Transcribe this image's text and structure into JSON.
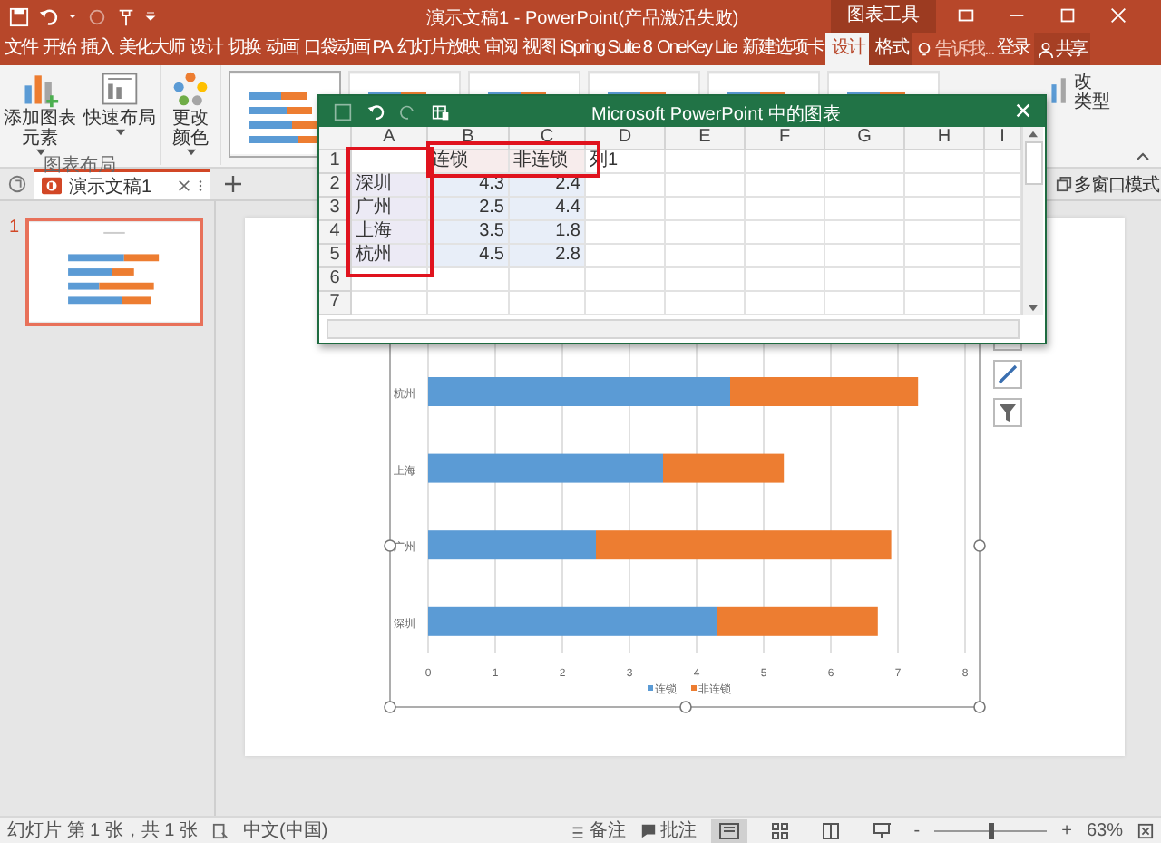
{
  "title_bar": {
    "title": "演示文稿1 - PowerPoint(产品激活失败)",
    "context_label": "图表工具"
  },
  "ribbon_tabs": [
    {
      "label": "文件",
      "kind": "main",
      "selected": false
    },
    {
      "label": "开始",
      "kind": "main",
      "selected": false
    },
    {
      "label": "插入",
      "kind": "main",
      "selected": false
    },
    {
      "label": "美化大师",
      "kind": "main",
      "selected": false
    },
    {
      "label": "设计",
      "kind": "main",
      "selected": false
    },
    {
      "label": "切换",
      "kind": "main",
      "selected": false
    },
    {
      "label": "动画",
      "kind": "main",
      "selected": false
    },
    {
      "label": "口袋动画 PA",
      "kind": "main",
      "selected": false
    },
    {
      "label": "幻灯片放映",
      "kind": "main",
      "selected": false
    },
    {
      "label": "审阅",
      "kind": "main",
      "selected": false
    },
    {
      "label": "视图",
      "kind": "main",
      "selected": false
    },
    {
      "label": "iSpring Suite 8",
      "kind": "main",
      "selected": false
    },
    {
      "label": "OneKey Lite",
      "kind": "main",
      "selected": false
    },
    {
      "label": "新建选项卡",
      "kind": "main",
      "selected": false
    },
    {
      "label": "设计",
      "kind": "context",
      "selected": true
    },
    {
      "label": "格式",
      "kind": "context",
      "selected": false
    }
  ],
  "tell_me": "告诉我...",
  "sign_in": "登录",
  "share": "共享",
  "ribbon": {
    "buttons": [
      {
        "label": "添加图表元素",
        "kind": "elements"
      },
      {
        "label": "快速布局",
        "kind": "layout"
      },
      {
        "label": "更改颜色",
        "kind": "colors"
      }
    ],
    "group_label": "图表布局",
    "partial_texts": [
      "改",
      "类型"
    ]
  },
  "doc_tab": {
    "title": "演示文稿1"
  },
  "multi_window": "多窗口模式",
  "slides": [
    {
      "number": "1",
      "selected": true
    }
  ],
  "chart_data": {
    "type": "bar",
    "orientation": "horizontal",
    "stacked": true,
    "grid": true,
    "legend": "bottom",
    "categories": [
      "杭州",
      "上海",
      "广州",
      "深圳"
    ],
    "series": [
      {
        "name": "连锁",
        "color": "#5b9bd5",
        "values": [
          4.5,
          3.5,
          2.5,
          4.3
        ]
      },
      {
        "name": "非连锁",
        "color": "#ed7d31",
        "values": [
          2.8,
          1.8,
          4.4,
          2.4
        ]
      }
    ],
    "xlim": [
      0,
      8
    ],
    "xticks": [
      0,
      1,
      2,
      3,
      4,
      5,
      6,
      7,
      8
    ]
  },
  "excel": {
    "title": "Microsoft PowerPoint 中的图表",
    "columns": [
      "A",
      "B",
      "C",
      "D",
      "E",
      "F",
      "G",
      "H",
      "I"
    ],
    "rows": [
      {
        "number": "1",
        "cells": [
          null,
          "连锁",
          "非连锁",
          "列1"
        ]
      },
      {
        "number": "2",
        "cells": [
          "深圳",
          "4.3",
          "2.4"
        ]
      },
      {
        "number": "3",
        "cells": [
          "广州",
          "2.5",
          "4.4"
        ]
      },
      {
        "number": "4",
        "cells": [
          "上海",
          "3.5",
          "1.8"
        ]
      },
      {
        "number": "5",
        "cells": [
          "杭州",
          "4.5",
          "2.8"
        ]
      },
      {
        "number": "6"
      },
      {
        "number": "7"
      }
    ]
  },
  "status_bar": {
    "slide_info": "幻灯片 第 1 张，共 1 张",
    "language": "中文(中国)",
    "notes": "备注",
    "comments": "批注",
    "zoom_out": "-",
    "zoom_in": "+",
    "zoom": {
      "level": 0.5,
      "reading": "63%"
    }
  }
}
